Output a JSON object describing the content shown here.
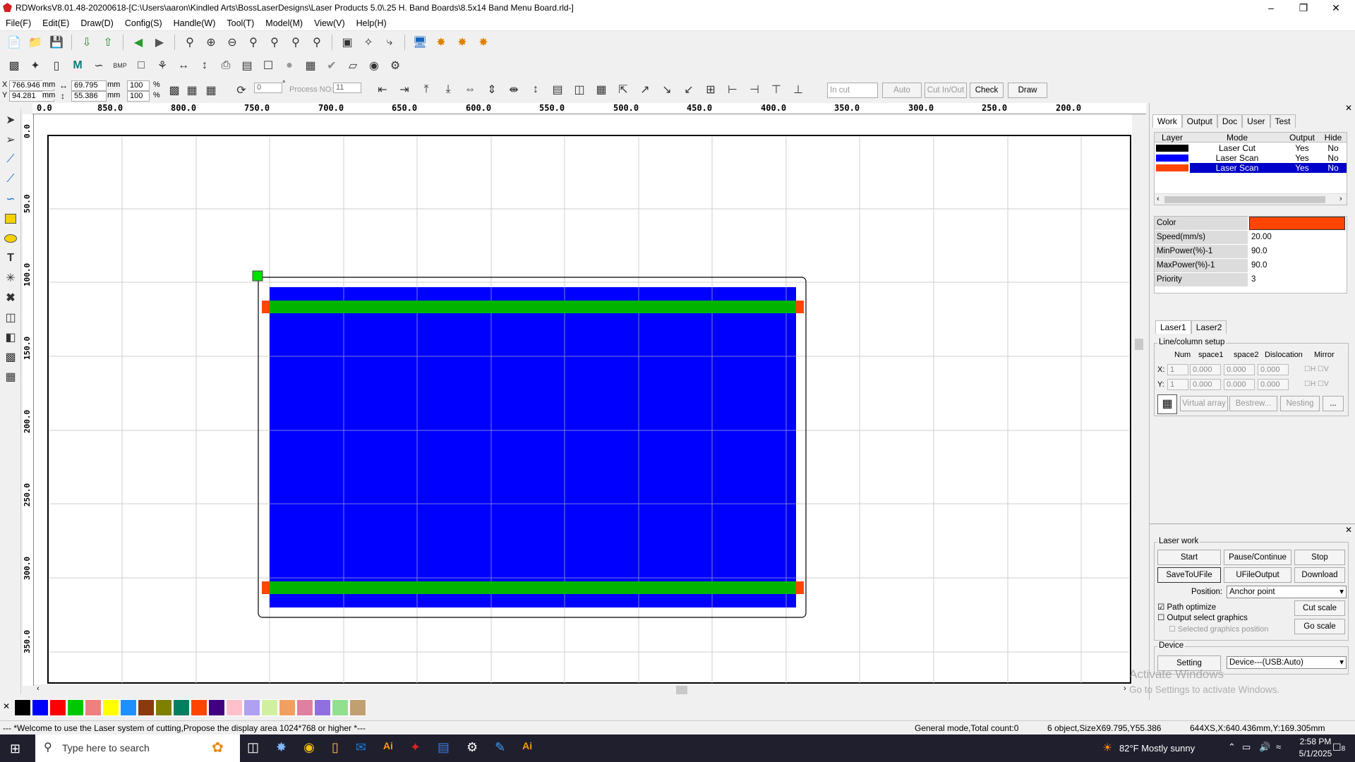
{
  "window": {
    "title": "RDWorksV8.01.48-20200618-[C:\\Users\\aaron\\Kindled Arts\\BossLaserDesigns\\Laser Products 5.0\\.25 H. Band Boards\\8.5x14 Band Menu Board.rld-]"
  },
  "menu": [
    "File(F)",
    "Edit(E)",
    "Draw(D)",
    "Config(S)",
    "Handle(W)",
    "Tool(T)",
    "Model(M)",
    "View(V)",
    "Help(H)"
  ],
  "coords": {
    "x_label": "X",
    "y_label": "Y",
    "x": "766.946",
    "y": "94.281",
    "w": "69.795",
    "h": "55.386",
    "unit": "mm",
    "sx": "100",
    "sy": "100",
    "pct": "%",
    "angle": "0",
    "deg": "°",
    "process_label": "Process NO:",
    "process_no": "11"
  },
  "toolbar3": {
    "in_cut": "In cut",
    "auto": "Auto",
    "cut_in_out": "Cut In/Out",
    "check": "Check",
    "draw": "Draw"
  },
  "hruler": [
    "0.0",
    "850.0",
    "800.0",
    "750.0",
    "700.0",
    "650.0",
    "600.0",
    "550.0",
    "500.0",
    "450.0",
    "400.0",
    "350.0",
    "300.0",
    "250.0",
    "200.0"
  ],
  "vruler": [
    "0.0",
    "50.0",
    "100.0",
    "150.0",
    "200.0",
    "250.0",
    "300.0",
    "350.0"
  ],
  "palette": [
    "#000000",
    "#0000ff",
    "#ff0000",
    "#00c800",
    "#f08080",
    "#ffff00",
    "#1e90ff",
    "#8b3a0f",
    "#808000",
    "#008060",
    "#ff4500",
    "#400080",
    "#ffc0cb",
    "#b0a0f0",
    "#d0f0a0",
    "#f0a060",
    "#e080a0",
    "#9070e0",
    "#90e090",
    "#c0a070"
  ],
  "status": {
    "welcome": "--- *Welcome to use the Laser system of cutting,Propose the display area 1024*768 or higher *---",
    "mode": "General mode,Total count:0",
    "objects": "6 object,SizeX69.795,Y55.386",
    "pos": "644XS,X:640.436mm,Y:169.305mm"
  },
  "panel": {
    "tabs": [
      "Work",
      "Output",
      "Doc",
      "User",
      "Test"
    ],
    "layer_headers": [
      "Layer",
      "Mode",
      "Output",
      "Hide"
    ],
    "layers": [
      {
        "color": "#000000",
        "mode": "Laser Cut",
        "output": "Yes",
        "hide": "No"
      },
      {
        "color": "#0000ff",
        "mode": "Laser Scan",
        "output": "Yes",
        "hide": "No"
      },
      {
        "color": "#ff4500",
        "mode": "Laser Scan",
        "output": "Yes",
        "hide": "No"
      }
    ],
    "props": [
      {
        "k": "Color",
        "v": ""
      },
      {
        "k": "Speed(mm/s)",
        "v": "20.00"
      },
      {
        "k": "MinPower(%)-1",
        "v": "90.0"
      },
      {
        "k": "MaxPower(%)-1",
        "v": "90.0"
      },
      {
        "k": "Priority",
        "v": "3"
      }
    ],
    "laser_tabs": [
      "Laser1",
      "Laser2"
    ],
    "array_title": "Line/column setup",
    "array_headers": [
      "Num",
      "space1",
      "space2",
      "Dislocation",
      "Mirror"
    ],
    "array_x": {
      "label": "X:",
      "num": "1",
      "s1": "0.000",
      "s2": "0.000",
      "d": "0.000"
    },
    "array_y": {
      "label": "Y:",
      "num": "1",
      "s1": "0.000",
      "s2": "0.000",
      "d": "0.000"
    },
    "mirror_h": "H",
    "mirror_v": "V",
    "array_buttons": [
      "Virtual array",
      "Bestrew...",
      "Nesting",
      "..."
    ],
    "laser_work": "Laser work",
    "work_buttons": [
      "Start",
      "Pause/Continue",
      "Stop",
      "SaveToUFile",
      "UFileOutput",
      "Download"
    ],
    "position_label": "Position:",
    "position_value": "Anchor point",
    "path_optimize": "Path optimize",
    "output_select": "Output select graphics",
    "selected_pos": "Selected graphics position",
    "cut_scale": "Cut scale",
    "go_scale": "Go scale",
    "device_title": "Device",
    "setting": "Setting",
    "device_value": "Device---(USB:Auto)"
  },
  "watermark": {
    "line1": "Activate Windows",
    "line2": "Go to Settings to activate Windows."
  },
  "taskbar": {
    "search": "Type here to search",
    "weather": "82°F  Mostly sunny",
    "time": "2:58 PM",
    "date": "5/1/2025",
    "notif": "8"
  }
}
